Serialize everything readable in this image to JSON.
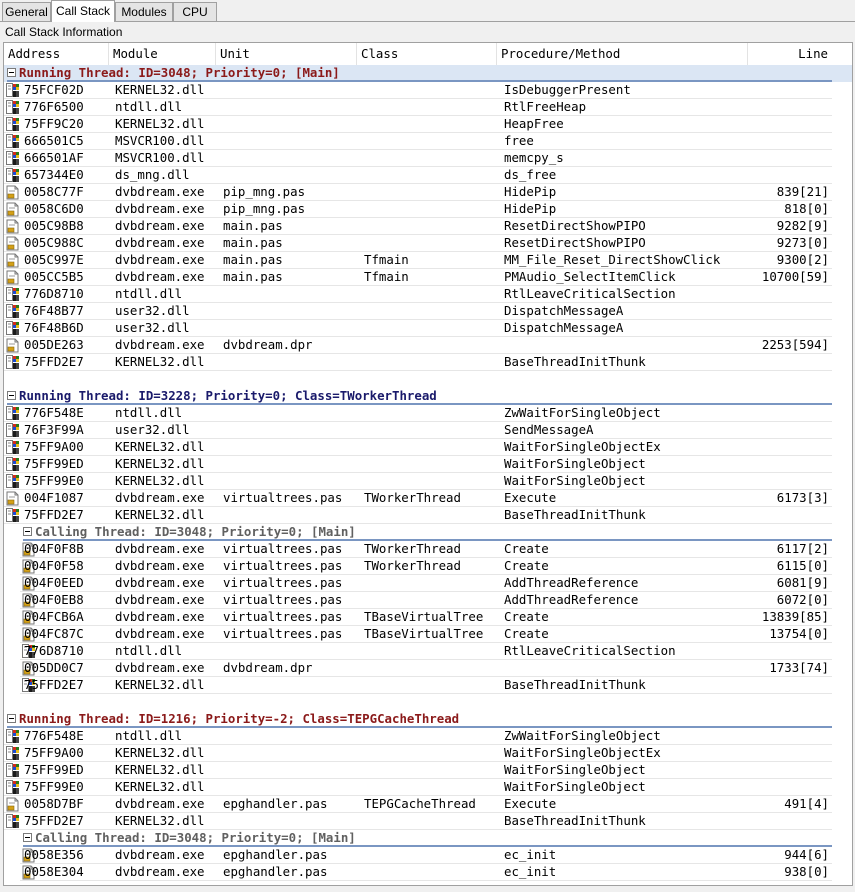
{
  "tabs": [
    "General",
    "Call Stack",
    "Modules",
    "CPU"
  ],
  "active_tab": "Call Stack",
  "section_title": "Call Stack Information",
  "columns": {
    "address": "Address",
    "module": "Module",
    "unit": "Unit",
    "class": "Class",
    "procedure": "Procedure/Method",
    "line": "Line"
  },
  "groups": [
    {
      "kind": "running",
      "label": "Running Thread: ID=3048; Priority=0; [Main]",
      "selected": true,
      "frames": [
        {
          "icon": "dll",
          "address": "75FCF02D",
          "module": "KERNEL32.dll",
          "unit": "",
          "class": "",
          "procedure": "IsDebuggerPresent",
          "line": ""
        },
        {
          "icon": "dll",
          "address": "776F6500",
          "module": "ntdll.dll",
          "unit": "",
          "class": "",
          "procedure": "RtlFreeHeap",
          "line": ""
        },
        {
          "icon": "dll",
          "address": "75FF9C20",
          "module": "KERNEL32.dll",
          "unit": "",
          "class": "",
          "procedure": "HeapFree",
          "line": ""
        },
        {
          "icon": "dll",
          "address": "666501C5",
          "module": "MSVCR100.dll",
          "unit": "",
          "class": "",
          "procedure": "free",
          "line": ""
        },
        {
          "icon": "dll",
          "address": "666501AF",
          "module": "MSVCR100.dll",
          "unit": "",
          "class": "",
          "procedure": "memcpy_s",
          "line": ""
        },
        {
          "icon": "dll",
          "address": "657344E0",
          "module": "ds_mng.dll",
          "unit": "",
          "class": "",
          "procedure": "ds_free",
          "line": ""
        },
        {
          "icon": "src",
          "address": "0058C77F",
          "module": "dvbdream.exe",
          "unit": "pip_mng.pas",
          "class": "",
          "procedure": "HidePip",
          "line": "839[21]"
        },
        {
          "icon": "src",
          "address": "0058C6D0",
          "module": "dvbdream.exe",
          "unit": "pip_mng.pas",
          "class": "",
          "procedure": "HidePip",
          "line": "818[0]"
        },
        {
          "icon": "src",
          "address": "005C98B8",
          "module": "dvbdream.exe",
          "unit": "main.pas",
          "class": "",
          "procedure": "ResetDirectShowPIPO",
          "line": "9282[9]"
        },
        {
          "icon": "src",
          "address": "005C988C",
          "module": "dvbdream.exe",
          "unit": "main.pas",
          "class": "",
          "procedure": "ResetDirectShowPIPO",
          "line": "9273[0]"
        },
        {
          "icon": "src",
          "address": "005C997E",
          "module": "dvbdream.exe",
          "unit": "main.pas",
          "class": "Tfmain",
          "procedure": "MM_File_Reset_DirectShowClick",
          "line": "9300[2]"
        },
        {
          "icon": "src",
          "address": "005CC5B5",
          "module": "dvbdream.exe",
          "unit": "main.pas",
          "class": "Tfmain",
          "procedure": "PMAudio_SelectItemClick",
          "line": "10700[59]"
        },
        {
          "icon": "dll",
          "address": "776D8710",
          "module": "ntdll.dll",
          "unit": "",
          "class": "",
          "procedure": "RtlLeaveCriticalSection",
          "line": ""
        },
        {
          "icon": "dll",
          "address": "76F48B77",
          "module": "user32.dll",
          "unit": "",
          "class": "",
          "procedure": "DispatchMessageA",
          "line": ""
        },
        {
          "icon": "dll",
          "address": "76F48B6D",
          "module": "user32.dll",
          "unit": "",
          "class": "",
          "procedure": "DispatchMessageA",
          "line": ""
        },
        {
          "icon": "src",
          "address": "005DE263",
          "module": "dvbdream.exe",
          "unit": "dvbdream.dpr",
          "class": "",
          "procedure": "",
          "line": "2253[594]"
        },
        {
          "icon": "dll",
          "address": "75FFD2E7",
          "module": "KERNEL32.dll",
          "unit": "",
          "class": "",
          "procedure": "BaseThreadInitThunk",
          "line": ""
        }
      ]
    },
    {
      "kind": "running2",
      "label": "Running Thread: ID=3228; Priority=0; Class=TWorkerThread",
      "frames": [
        {
          "icon": "dll",
          "address": "776F548E",
          "module": "ntdll.dll",
          "unit": "",
          "class": "",
          "procedure": "ZwWaitForSingleObject",
          "line": ""
        },
        {
          "icon": "dll",
          "address": "76F3F99A",
          "module": "user32.dll",
          "unit": "",
          "class": "",
          "procedure": "SendMessageA",
          "line": ""
        },
        {
          "icon": "dll",
          "address": "75FF9A00",
          "module": "KERNEL32.dll",
          "unit": "",
          "class": "",
          "procedure": "WaitForSingleObjectEx",
          "line": ""
        },
        {
          "icon": "dll",
          "address": "75FF99ED",
          "module": "KERNEL32.dll",
          "unit": "",
          "class": "",
          "procedure": "WaitForSingleObject",
          "line": ""
        },
        {
          "icon": "dll",
          "address": "75FF99E0",
          "module": "KERNEL32.dll",
          "unit": "",
          "class": "",
          "procedure": "WaitForSingleObject",
          "line": ""
        },
        {
          "icon": "src",
          "address": "004F1087",
          "module": "dvbdream.exe",
          "unit": "virtualtrees.pas",
          "class": "TWorkerThread",
          "procedure": "Execute",
          "line": "6173[3]"
        },
        {
          "icon": "dll",
          "address": "75FFD2E7",
          "module": "KERNEL32.dll",
          "unit": "",
          "class": "",
          "procedure": "BaseThreadInitThunk",
          "line": ""
        }
      ]
    },
    {
      "kind": "calling",
      "label": "Calling Thread: ID=3048; Priority=0; [Main]",
      "frames": [
        {
          "icon": "src",
          "address": "004F0F8B",
          "module": "dvbdream.exe",
          "unit": "virtualtrees.pas",
          "class": "TWorkerThread",
          "procedure": "Create",
          "line": "6117[2]"
        },
        {
          "icon": "src",
          "address": "004F0F58",
          "module": "dvbdream.exe",
          "unit": "virtualtrees.pas",
          "class": "TWorkerThread",
          "procedure": "Create",
          "line": "6115[0]"
        },
        {
          "icon": "src",
          "address": "004F0EED",
          "module": "dvbdream.exe",
          "unit": "virtualtrees.pas",
          "class": "",
          "procedure": "AddThreadReference",
          "line": "6081[9]"
        },
        {
          "icon": "src",
          "address": "004F0EB8",
          "module": "dvbdream.exe",
          "unit": "virtualtrees.pas",
          "class": "",
          "procedure": "AddThreadReference",
          "line": "6072[0]"
        },
        {
          "icon": "src",
          "address": "004FCB6A",
          "module": "dvbdream.exe",
          "unit": "virtualtrees.pas",
          "class": "TBaseVirtualTree",
          "procedure": "Create",
          "line": "13839[85]"
        },
        {
          "icon": "src",
          "address": "004FC87C",
          "module": "dvbdream.exe",
          "unit": "virtualtrees.pas",
          "class": "TBaseVirtualTree",
          "procedure": "Create",
          "line": "13754[0]"
        },
        {
          "icon": "dll",
          "address": "776D8710",
          "module": "ntdll.dll",
          "unit": "",
          "class": "",
          "procedure": "RtlLeaveCriticalSection",
          "line": ""
        },
        {
          "icon": "src",
          "address": "005DD0C7",
          "module": "dvbdream.exe",
          "unit": "dvbdream.dpr",
          "class": "",
          "procedure": "",
          "line": "1733[74]"
        },
        {
          "icon": "dll",
          "address": "75FFD2E7",
          "module": "KERNEL32.dll",
          "unit": "",
          "class": "",
          "procedure": "BaseThreadInitThunk",
          "line": ""
        }
      ]
    },
    {
      "kind": "running",
      "label": "Running Thread: ID=1216; Priority=-2; Class=TEPGCacheThread",
      "frames": [
        {
          "icon": "dll",
          "address": "776F548E",
          "module": "ntdll.dll",
          "unit": "",
          "class": "",
          "procedure": "ZwWaitForSingleObject",
          "line": ""
        },
        {
          "icon": "dll",
          "address": "75FF9A00",
          "module": "KERNEL32.dll",
          "unit": "",
          "class": "",
          "procedure": "WaitForSingleObjectEx",
          "line": ""
        },
        {
          "icon": "dll",
          "address": "75FF99ED",
          "module": "KERNEL32.dll",
          "unit": "",
          "class": "",
          "procedure": "WaitForSingleObject",
          "line": ""
        },
        {
          "icon": "dll",
          "address": "75FF99E0",
          "module": "KERNEL32.dll",
          "unit": "",
          "class": "",
          "procedure": "WaitForSingleObject",
          "line": ""
        },
        {
          "icon": "src",
          "address": "0058D7BF",
          "module": "dvbdream.exe",
          "unit": "epghandler.pas",
          "class": "TEPGCacheThread",
          "procedure": "Execute",
          "line": "491[4]"
        },
        {
          "icon": "dll",
          "address": "75FFD2E7",
          "module": "KERNEL32.dll",
          "unit": "",
          "class": "",
          "procedure": "BaseThreadInitThunk",
          "line": ""
        }
      ]
    },
    {
      "kind": "calling",
      "label": "Calling Thread: ID=3048; Priority=0; [Main]",
      "frames": [
        {
          "icon": "src",
          "address": "0058E356",
          "module": "dvbdream.exe",
          "unit": "epghandler.pas",
          "class": "",
          "procedure": "ec_init",
          "line": "944[6]"
        },
        {
          "icon": "src",
          "address": "0058E304",
          "module": "dvbdream.exe",
          "unit": "epghandler.pas",
          "class": "",
          "procedure": "ec_init",
          "line": "938[0]"
        }
      ]
    }
  ]
}
